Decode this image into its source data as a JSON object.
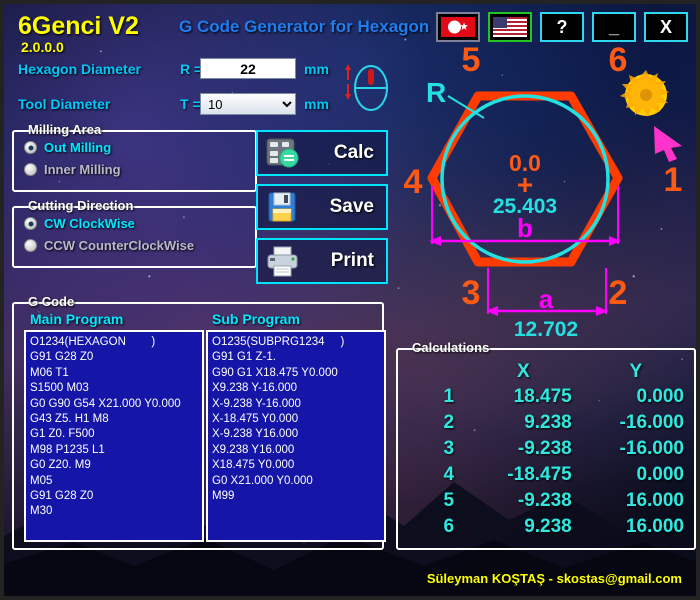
{
  "window": {
    "title": "6Genci V2",
    "version": "2.0.0.0",
    "subtitle": "G Code Generator for Hexagon"
  },
  "titlebar": {
    "buttons": [
      {
        "name": "lang-tr",
        "icon": "turkish-flag-icon",
        "label": ""
      },
      {
        "name": "lang-en",
        "icon": "us-flag-icon",
        "label": ""
      },
      {
        "name": "help",
        "icon": "question-icon",
        "label": "?"
      },
      {
        "name": "minimize",
        "icon": "minimize-icon",
        "label": "_"
      },
      {
        "name": "close",
        "icon": "close-icon",
        "label": "X"
      }
    ]
  },
  "inputs": {
    "hexagon_diameter_label": "Hexagon Diameter",
    "hexagon_diameter_symbol": "R =",
    "hexagon_diameter_value": "22",
    "hexagon_diameter_unit": "mm",
    "tool_diameter_label": "Tool Diameter",
    "tool_diameter_symbol": "T =",
    "tool_diameter_value": "10",
    "tool_diameter_unit": "mm",
    "tool_diameter_options": [
      "10"
    ]
  },
  "milling_area": {
    "title": "Milling Area",
    "options": [
      {
        "label": "Out Milling",
        "selected": true
      },
      {
        "label": "Inner Milling",
        "selected": false
      }
    ]
  },
  "cutting_direction": {
    "title": "Cutting Direction",
    "options": [
      {
        "label": "CW ClockWise",
        "selected": true
      },
      {
        "label": "CCW CounterClockWise",
        "selected": false
      }
    ]
  },
  "actions": {
    "calc_label": "Calc",
    "save_label": "Save",
    "print_label": "Print"
  },
  "gcode": {
    "title": "G Code",
    "main_title": "Main Program",
    "sub_title": "Sub Program",
    "main_program": "O1234(HEXAGON        )\nG91 G28 Z0\nM06 T1\nS1500 M03\nG0 G90 G54 X21.000 Y0.000\nG43 Z5. H1 M8\nG1 Z0. F500\nM98 P1235 L1\nG0 Z20. M9\nM05\nG91 G28 Z0\nM30",
    "sub_program": "O1235(SUBPRG1234     )\nG91 G1 Z-1.\nG90 G1 X18.475 Y0.000\nX9.238 Y-16.000\nX-9.238 Y-16.000\nX-18.475 Y0.000\nX-9.238 Y16.000\nX9.238 Y16.000\nX18.475 Y0.000\nG0 X21.000 Y0.000\nM99"
  },
  "calculations": {
    "title": "Calculations",
    "headers": {
      "n": "",
      "x": "X",
      "y": "Y"
    },
    "rows": [
      {
        "n": "1",
        "x": "18.475",
        "y": "0.000"
      },
      {
        "n": "2",
        "x": "9.238",
        "y": "-16.000"
      },
      {
        "n": "3",
        "x": "-9.238",
        "y": "-16.000"
      },
      {
        "n": "4",
        "x": "-18.475",
        "y": "0.000"
      },
      {
        "n": "5",
        "x": "-9.238",
        "y": "16.000"
      },
      {
        "n": "6",
        "x": "9.238",
        "y": "16.000"
      }
    ]
  },
  "diagram": {
    "vertex_labels": [
      "1",
      "2",
      "3",
      "4",
      "5",
      "6"
    ],
    "radius_label": "R",
    "center_label": "0.0",
    "center_marker": "+",
    "width_value": "25.403",
    "width_label": "b",
    "side_value": "12.702",
    "side_label": "a",
    "hexagon_color": "#ff3c00",
    "circle_color": "#24e0e0",
    "dimension_color": "#ff00ff",
    "value_color": "#24e0e0"
  },
  "footer": {
    "credit": "Süleyman KOŞTAŞ - skostas@gmail.com"
  }
}
